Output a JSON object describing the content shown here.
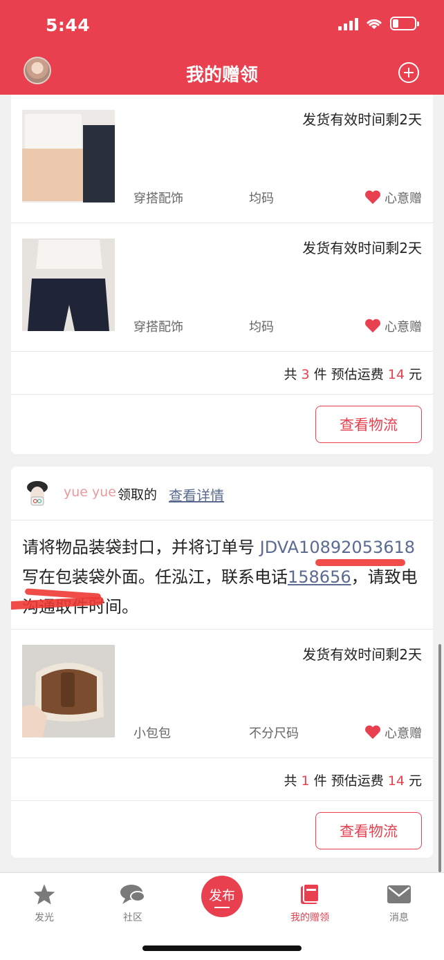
{
  "status_bar": {
    "time": "5:44"
  },
  "header": {
    "title": "我的赠领"
  },
  "order1": {
    "items": [
      {
        "ship_time": "发货有效时间剩2天",
        "category": "穿搭配饰",
        "size": "均码",
        "gift_label": "心意赠"
      },
      {
        "ship_time": "发货有效时间剩2天",
        "category": "穿搭配饰",
        "size": "均码",
        "gift_label": "心意赠"
      }
    ],
    "summary": {
      "prefix": "共",
      "count": "3",
      "mid": "件 预估运费",
      "fee": "14",
      "suffix": "元"
    },
    "logistics_label": "查看物流"
  },
  "order2": {
    "claimer_name": "yue yue",
    "claimed_word": "领取的",
    "detail_link": "查看详情",
    "notice": {
      "part1": "请将物品装袋封口，并将订单号 ",
      "order_code": "JDVA10892053618",
      "part2": " 写在包装袋外面。任泓江，联系电话",
      "phone": "158656",
      "part3": "，请致电沟通取件时间。"
    },
    "items": [
      {
        "ship_time": "发货有效时间剩2天",
        "category": "小包包",
        "size": "不分尺码",
        "gift_label": "心意赠"
      }
    ],
    "summary": {
      "prefix": "共",
      "count": "1",
      "mid": "件 预估运费",
      "fee": "14",
      "suffix": "元"
    },
    "logistics_label": "查看物流"
  },
  "tabbar": {
    "tabs": [
      {
        "label": "发光",
        "icon": "star-icon"
      },
      {
        "label": "社区",
        "icon": "chat-bubble-icon"
      },
      {
        "label": "发布",
        "icon": "publish-icon"
      },
      {
        "label": "我的赠领",
        "icon": "gift-box-icon"
      },
      {
        "label": "消息",
        "icon": "mail-icon"
      }
    ]
  },
  "colors": {
    "brand": "#e8404f",
    "link": "#5a6a91"
  }
}
